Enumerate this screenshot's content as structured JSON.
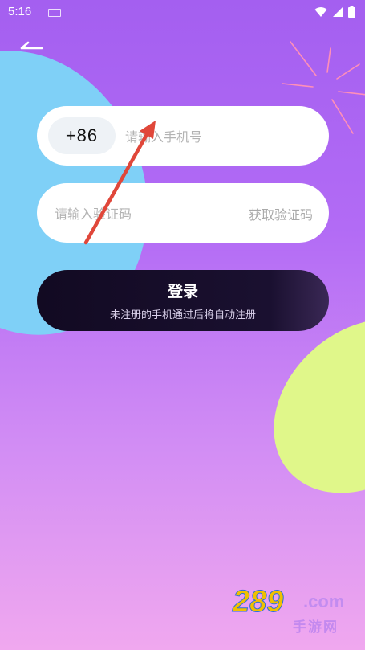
{
  "status_bar": {
    "time": "5:16"
  },
  "phone": {
    "country_code": "+86",
    "placeholder": "请输入手机号"
  },
  "verification": {
    "placeholder": "请输入验证码",
    "get_code_label": "获取验证码"
  },
  "login": {
    "label": "登录",
    "note": "未注册的手机通过后将自动注册"
  },
  "watermark": {
    "number": "289",
    "domain": ".com",
    "cn": "手游网"
  },
  "colors": {
    "background_top": "#a45ff0",
    "background_bottom": "#f0a8ef",
    "blob_blue": "#7fd0f7",
    "blob_green": "#e0f78a",
    "button_dark": "#120a22",
    "annotation_arrow": "#e0473a"
  },
  "icons": [
    "keyboard-icon",
    "wifi-icon",
    "signal-icon",
    "battery-icon",
    "back-arrow-icon",
    "sparkle-decoration"
  ]
}
